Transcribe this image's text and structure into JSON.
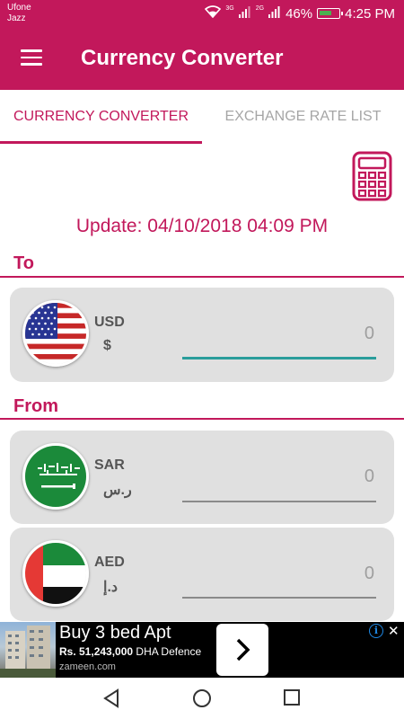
{
  "status_bar": {
    "carrier_1": "Ufone",
    "carrier_2": "Jazz",
    "net_1": "3G",
    "net_2": "2G",
    "battery": "46%",
    "time": "4:25 PM"
  },
  "toolbar": {
    "title": "Currency Converter"
  },
  "tabs": [
    {
      "label": "CURRENCY CONVERTER",
      "selected": true
    },
    {
      "label": "EXCHANGE RATE LIST",
      "selected": false
    }
  ],
  "update_text": "Update: 04/10/2018 04:09 PM",
  "to_section": {
    "label": "To",
    "currency": {
      "code": "USD",
      "symbol": "$",
      "amount_placeholder": "0"
    }
  },
  "from_section": {
    "label": "From",
    "currencies": [
      {
        "code": "SAR",
        "symbol": "ر.س",
        "amount_placeholder": "0"
      },
      {
        "code": "AED",
        "symbol": "د.إ",
        "amount_placeholder": "0"
      }
    ]
  },
  "ad": {
    "headline": "Buy 3 bed Apt",
    "price": "Rs. 51,243,000",
    "tagline": "DHA Defence",
    "domain": "zameen.com"
  },
  "icons": [
    "hamburger-icon",
    "calculator-icon",
    "usa-flag-icon",
    "saudi-flag-icon",
    "uae-flag-icon",
    "chevron-right-icon",
    "ad-info-icon",
    "close-icon",
    "nav-back-icon",
    "nav-home-icon",
    "nav-recents-icon"
  ],
  "colors": {
    "primary": "#c2185b",
    "card": "#e0e0e0",
    "accent_underline": "#2a9d9b"
  }
}
